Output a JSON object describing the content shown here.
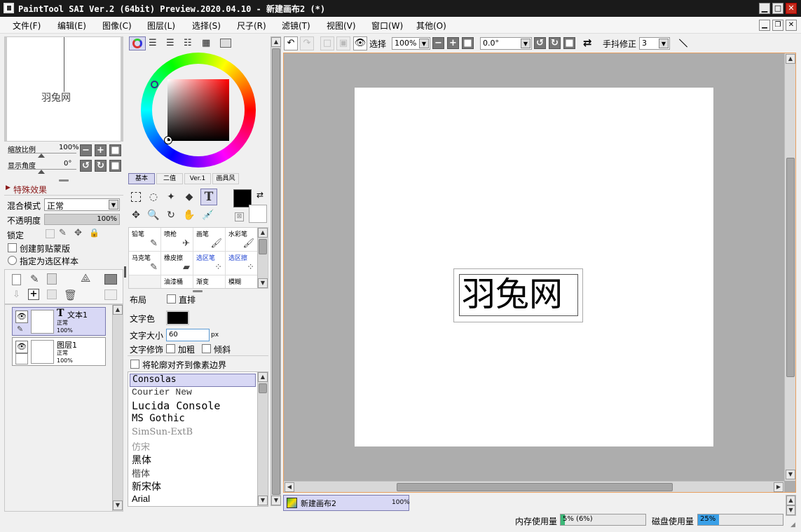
{
  "window": {
    "title": "PaintTool SAI Ver.2 (64bit) Preview.2020.04.10 - 新建画布2 (*)",
    "minimize": "▁",
    "maximize": "□",
    "close": "✕"
  },
  "menu": [
    "文件(F)",
    "编辑(E)",
    "图像(C)",
    "图层(L)",
    "选择(S)",
    "尺子(R)",
    "滤镜(T)",
    "视图(V)",
    "窗口(W)",
    "其他(O)"
  ],
  "mdi": {
    "minimize": "▁",
    "restore": "❐",
    "close": "✕"
  },
  "navigator": {
    "preview_text": "羽兔网",
    "zoom_label": "缩放比例",
    "zoom_value": "100%",
    "angle_label": "显示角度",
    "angle_value": "0°"
  },
  "effects": {
    "header": "特殊效果"
  },
  "layer_props": {
    "blend_label": "混合模式",
    "blend_value": "正常",
    "opacity_label": "不透明度",
    "opacity_value": "100%",
    "lock_label": "锁定",
    "clip_label": "创建剪贴蒙版",
    "sample_label": "指定为选区样本"
  },
  "layers": [
    {
      "name": "文本1",
      "mode": "正常",
      "opacity": "100%",
      "type": "T"
    },
    {
      "name": "图层1",
      "mode": "正常",
      "opacity": "100%",
      "type": ""
    }
  ],
  "color_tabs": [
    "基本",
    "二值",
    "Ver.1",
    "画具风"
  ],
  "colors": {
    "hue_ring": "#ff0000",
    "fg": "#000000",
    "bg": "#ffffff",
    "accent": "#7a7ab0"
  },
  "brushes": [
    {
      "name": "铅笔",
      "icon": "✎"
    },
    {
      "name": "喷枪",
      "icon": "✈"
    },
    {
      "name": "画笔",
      "icon": "🖌"
    },
    {
      "name": "水彩笔",
      "icon": "🖌"
    },
    {
      "name": "马克笔",
      "icon": "✎"
    },
    {
      "name": "橡皮擦",
      "icon": "▰"
    },
    {
      "name": "选区笔",
      "icon": "⁘"
    },
    {
      "name": "选区擦",
      "icon": "⁘"
    },
    {
      "name": "",
      "icon": ""
    },
    {
      "name": "油漆桶",
      "icon": ""
    },
    {
      "name": "渐变",
      "icon": ""
    },
    {
      "name": "模糊",
      "icon": ""
    }
  ],
  "text_tool": {
    "layout_label": "布局",
    "vertical_label": "直排",
    "color_label": "文字色",
    "size_label": "文字大小",
    "size_value": "60",
    "size_unit": "px",
    "style_label": "文字修饰",
    "bold_label": "加粗",
    "italic_label": "倾斜",
    "align_label": "将轮廓对齐到像素边界"
  },
  "fonts": [
    "Consolas",
    "Courier New",
    "Lucida Console",
    "MS Gothic",
    "SimSun-ExtB",
    "仿宋",
    "黑体",
    "楷体",
    "新宋体",
    "Arial"
  ],
  "canvas_toolbar": {
    "select_label": "选择",
    "zoom_value": "100%",
    "angle_value": "0.0°",
    "stabilizer_label": "手抖修正",
    "stabilizer_value": "3"
  },
  "canvas": {
    "text": "羽兔网"
  },
  "tabs": [
    {
      "name": "新建画布2",
      "zoom": "100%"
    }
  ],
  "status": {
    "mem_label": "内存使用量",
    "mem_value": "5% (6%)",
    "mem_fraction": 0.05,
    "disk_label": "磁盘使用量",
    "disk_value": "25%",
    "disk_fraction": 0.25
  }
}
